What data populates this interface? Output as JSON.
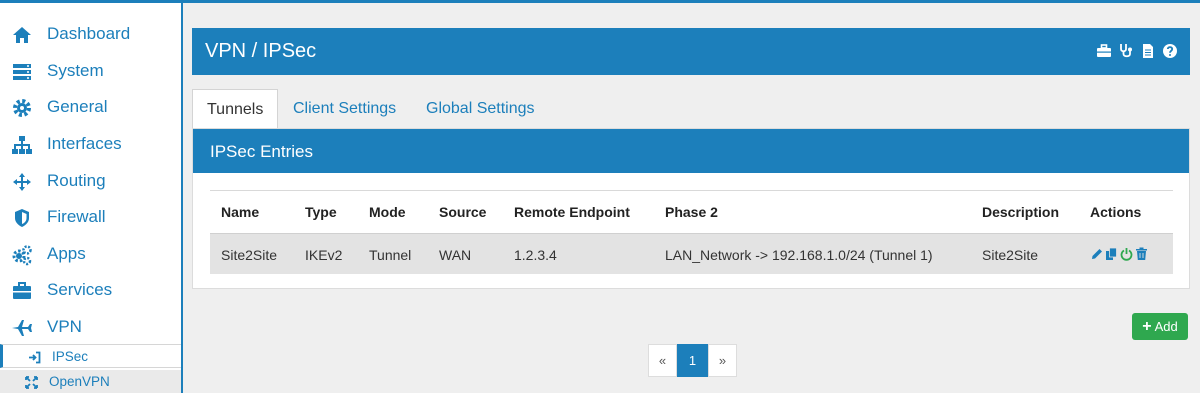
{
  "sidebar": {
    "items": [
      {
        "label": "Dashboard",
        "icon": "home-icon"
      },
      {
        "label": "System",
        "icon": "server-icon"
      },
      {
        "label": "General",
        "icon": "gear-icon"
      },
      {
        "label": "Interfaces",
        "icon": "sitemap-icon"
      },
      {
        "label": "Routing",
        "icon": "arrows-icon"
      },
      {
        "label": "Firewall",
        "icon": "shield-icon"
      },
      {
        "label": "Apps",
        "icon": "cogs-icon"
      },
      {
        "label": "Services",
        "icon": "briefcase-icon"
      },
      {
        "label": "VPN",
        "icon": "plane-icon"
      }
    ],
    "subitems": [
      {
        "label": "IPSec",
        "icon": "sign-in-icon"
      },
      {
        "label": "OpenVPN",
        "icon": "expand-icon"
      }
    ]
  },
  "header": {
    "title": "VPN / IPSec",
    "icons": [
      "briefcase-icon",
      "stethoscope-icon",
      "document-icon",
      "help-icon"
    ]
  },
  "tabs": [
    {
      "label": "Tunnels"
    },
    {
      "label": "Client Settings"
    },
    {
      "label": "Global Settings"
    }
  ],
  "panel": {
    "title": "IPSec Entries",
    "columns": [
      "Name",
      "Type",
      "Mode",
      "Source",
      "Remote Endpoint",
      "Phase 2",
      "Description",
      "Actions"
    ],
    "rows": [
      {
        "name": "Site2Site",
        "type": "IKEv2",
        "mode": "Tunnel",
        "source": "WAN",
        "remote_endpoint": "1.2.3.4",
        "phase2": "LAN_Network -> 192.168.1.0/24 (Tunnel 1)",
        "description": "Site2Site",
        "actions": [
          "edit-icon",
          "copy-icon",
          "power-icon",
          "trash-icon"
        ]
      }
    ]
  },
  "add_button": {
    "label": "Add"
  },
  "pagination": {
    "prev": "«",
    "current": "1",
    "next": "»"
  },
  "colors": {
    "primary": "#1c7fbb",
    "success": "#2fa84f",
    "row_bg": "#e3e3e3"
  }
}
